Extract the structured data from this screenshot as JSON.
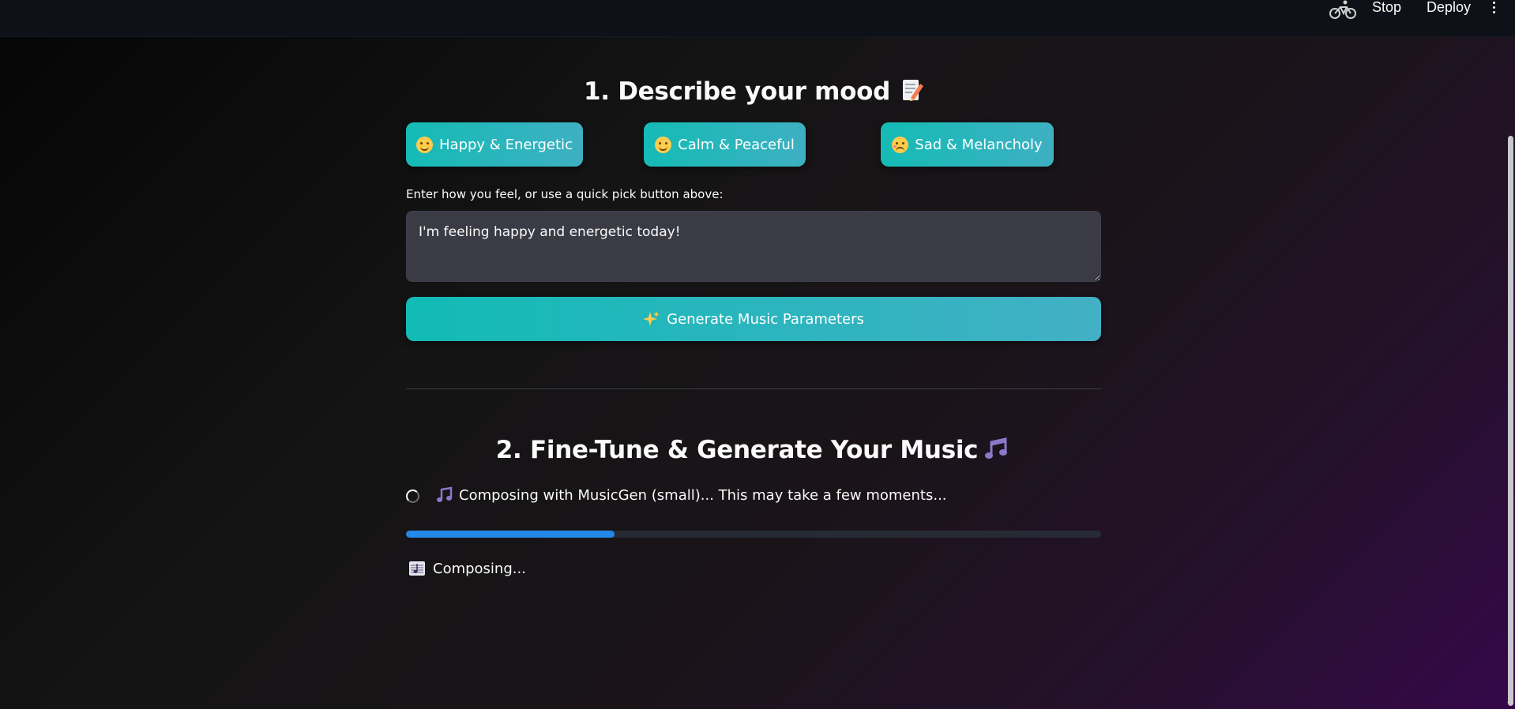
{
  "topbar": {
    "running_icon": "running-cyclist-icon",
    "stop_label": "Stop",
    "deploy_label": "Deploy",
    "menu_icon": "kebab-menu-icon"
  },
  "section1": {
    "title": "1. Describe your mood",
    "title_icon": "memo-pencil-icon",
    "quick_picks": [
      {
        "label": "Happy & Energetic",
        "icon": "smiling-face-icon"
      },
      {
        "label": "Calm & Peaceful",
        "icon": "relieved-face-icon"
      },
      {
        "label": "Sad & Melancholy",
        "icon": "flushed-face-icon"
      }
    ],
    "input_label": "Enter how you feel, or use a quick pick button above:",
    "input_value": "I'm feeling happy and energetic today!",
    "generate_label": "Generate Music Parameters",
    "generate_icon": "sparkles-icon"
  },
  "section2": {
    "title": "2. Fine-Tune & Generate Your Music",
    "title_icon": "musical-notes-icon",
    "status_text": "Composing with MusicGen (small)... This may take a few moments...",
    "status_icon": "musical-note-icon",
    "progress_fraction": 0.3,
    "composing_text": "Composing...",
    "composing_icon": "musical-score-icon"
  },
  "colors": {
    "accent_teal": "#14bbb5",
    "progress_blue": "#2488e8",
    "topbar": "#0e1117"
  }
}
